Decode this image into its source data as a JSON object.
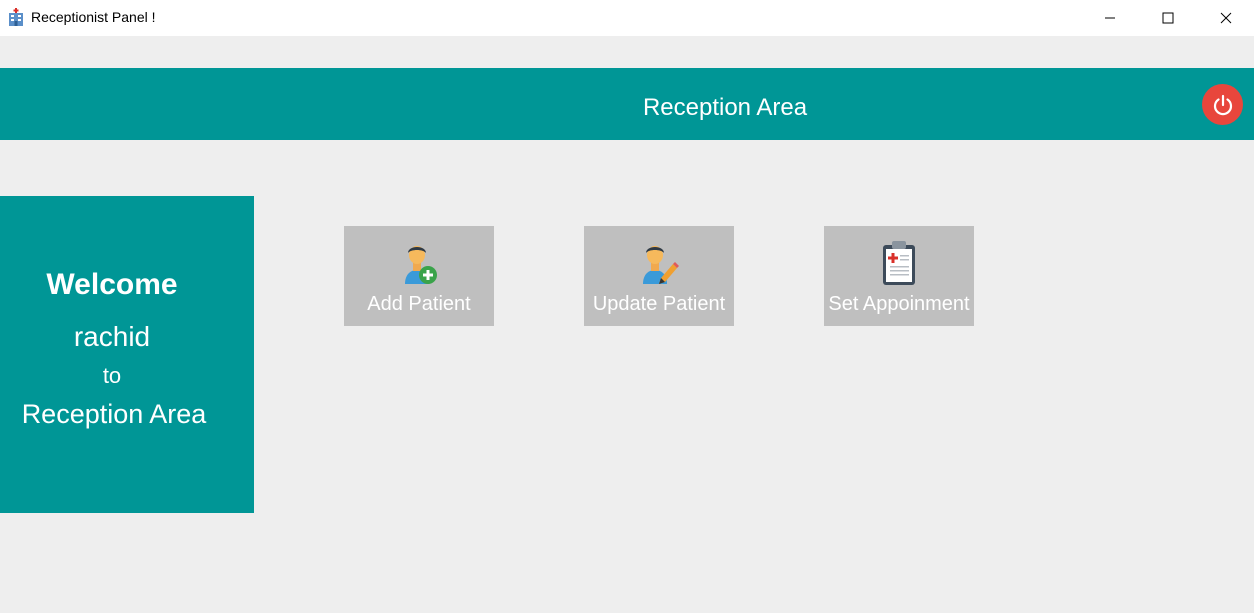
{
  "window": {
    "title": "Receptionist Panel !",
    "icon": "hospital-icon"
  },
  "header": {
    "title": "Reception Area",
    "power_icon": "power-icon"
  },
  "welcome": {
    "line1": "Welcome",
    "username": "rachid",
    "line3": "to",
    "line4": "Reception Area"
  },
  "actions": [
    {
      "label": "Add Patient",
      "icon": "add-user-icon"
    },
    {
      "label": "Update Patient",
      "icon": "edit-user-icon"
    },
    {
      "label": "Set Appoinment",
      "icon": "clipboard-icon"
    }
  ],
  "colors": {
    "accent": "#009696",
    "tile": "#bfbfbf",
    "background": "#eeeeee",
    "power": "#e8463c"
  }
}
